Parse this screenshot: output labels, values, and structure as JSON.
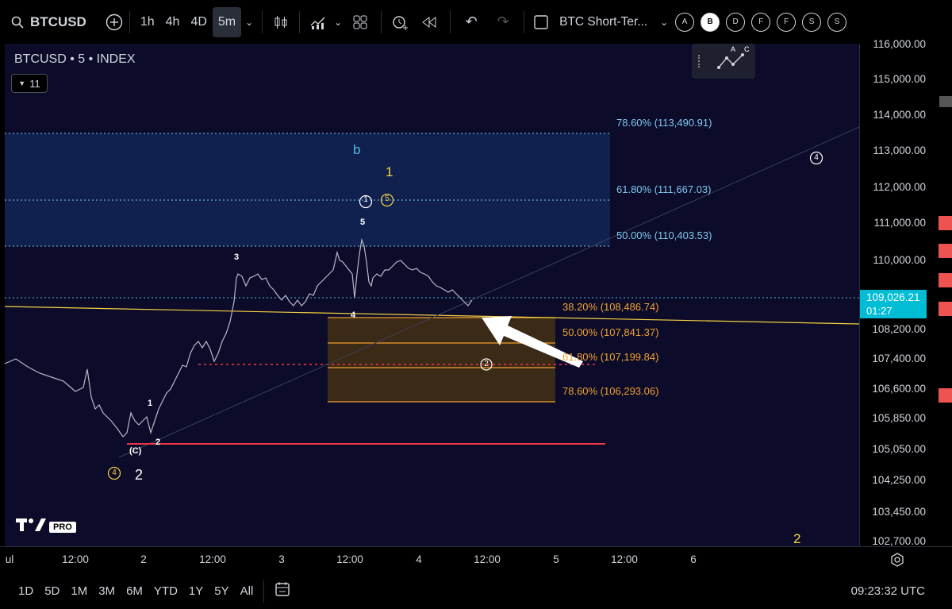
{
  "toolbar": {
    "symbol": "BTCUSD",
    "intervals": [
      "1h",
      "4h",
      "4D",
      "5m"
    ],
    "active_interval": "5m",
    "layout_name": "BTC Short-Ter...",
    "letter_buttons": [
      "A",
      "B",
      "D",
      "F",
      "F",
      "S",
      "S"
    ],
    "active_letter": "B"
  },
  "legend": {
    "title": "BTCUSD • 5 • INDEX",
    "indicator_count": "11"
  },
  "price_axis": {
    "labels": [
      "116,000.00",
      "115,000.00",
      "114,000.00",
      "113,000.00",
      "112,000.00",
      "111,000.00",
      "110,000.00",
      "108,200.00",
      "107,400.00",
      "106,600.00",
      "105,850.00",
      "105,050.00",
      "104,250.00",
      "103,450.00",
      "102,700.00"
    ],
    "current_price": "109,026.21",
    "countdown": "01:27",
    "current_bg": "#00bcd4"
  },
  "fib_upper": [
    {
      "label": "78.60% (113,490.91)"
    },
    {
      "label": "61.80% (111,667.03)"
    },
    {
      "label": "50.00% (110,403.53)"
    }
  ],
  "fib_lower": [
    {
      "label": "38.20% (108,486.74)"
    },
    {
      "label": "50.00% (107,841.37)"
    },
    {
      "label": "61.80% (107,199.84)"
    },
    {
      "label": "78.60% (106,293.06)"
    }
  ],
  "wave_labels": {
    "b": "b",
    "one_yellow": "1",
    "circ1": "1",
    "circ5": "5",
    "five": "5",
    "three": "3",
    "four": "4",
    "one": "1",
    "two_small": "2",
    "c_label": "(C)",
    "circ4_left": "4",
    "two_big": "2",
    "circ2": "2",
    "circ4_right": "4",
    "two_bottom": "2",
    "abc_a": "A",
    "abc_c": "C"
  },
  "time_axis": {
    "labels": [
      "ul",
      "12:00",
      "2",
      "12:00",
      "3",
      "12:00",
      "4",
      "12:00",
      "5",
      "12:00",
      "6"
    ]
  },
  "bottom": {
    "ranges": [
      "1D",
      "5D",
      "1M",
      "3M",
      "6M",
      "YTD",
      "1Y",
      "5Y",
      "All"
    ],
    "clock": "09:23:32 UTC"
  },
  "watermark": "PRO",
  "colors": {
    "upper_zone": "#12245a",
    "lower_zone": "#3a2a1a",
    "red_line": "#f23645",
    "yellow_line": "#f5d142"
  }
}
